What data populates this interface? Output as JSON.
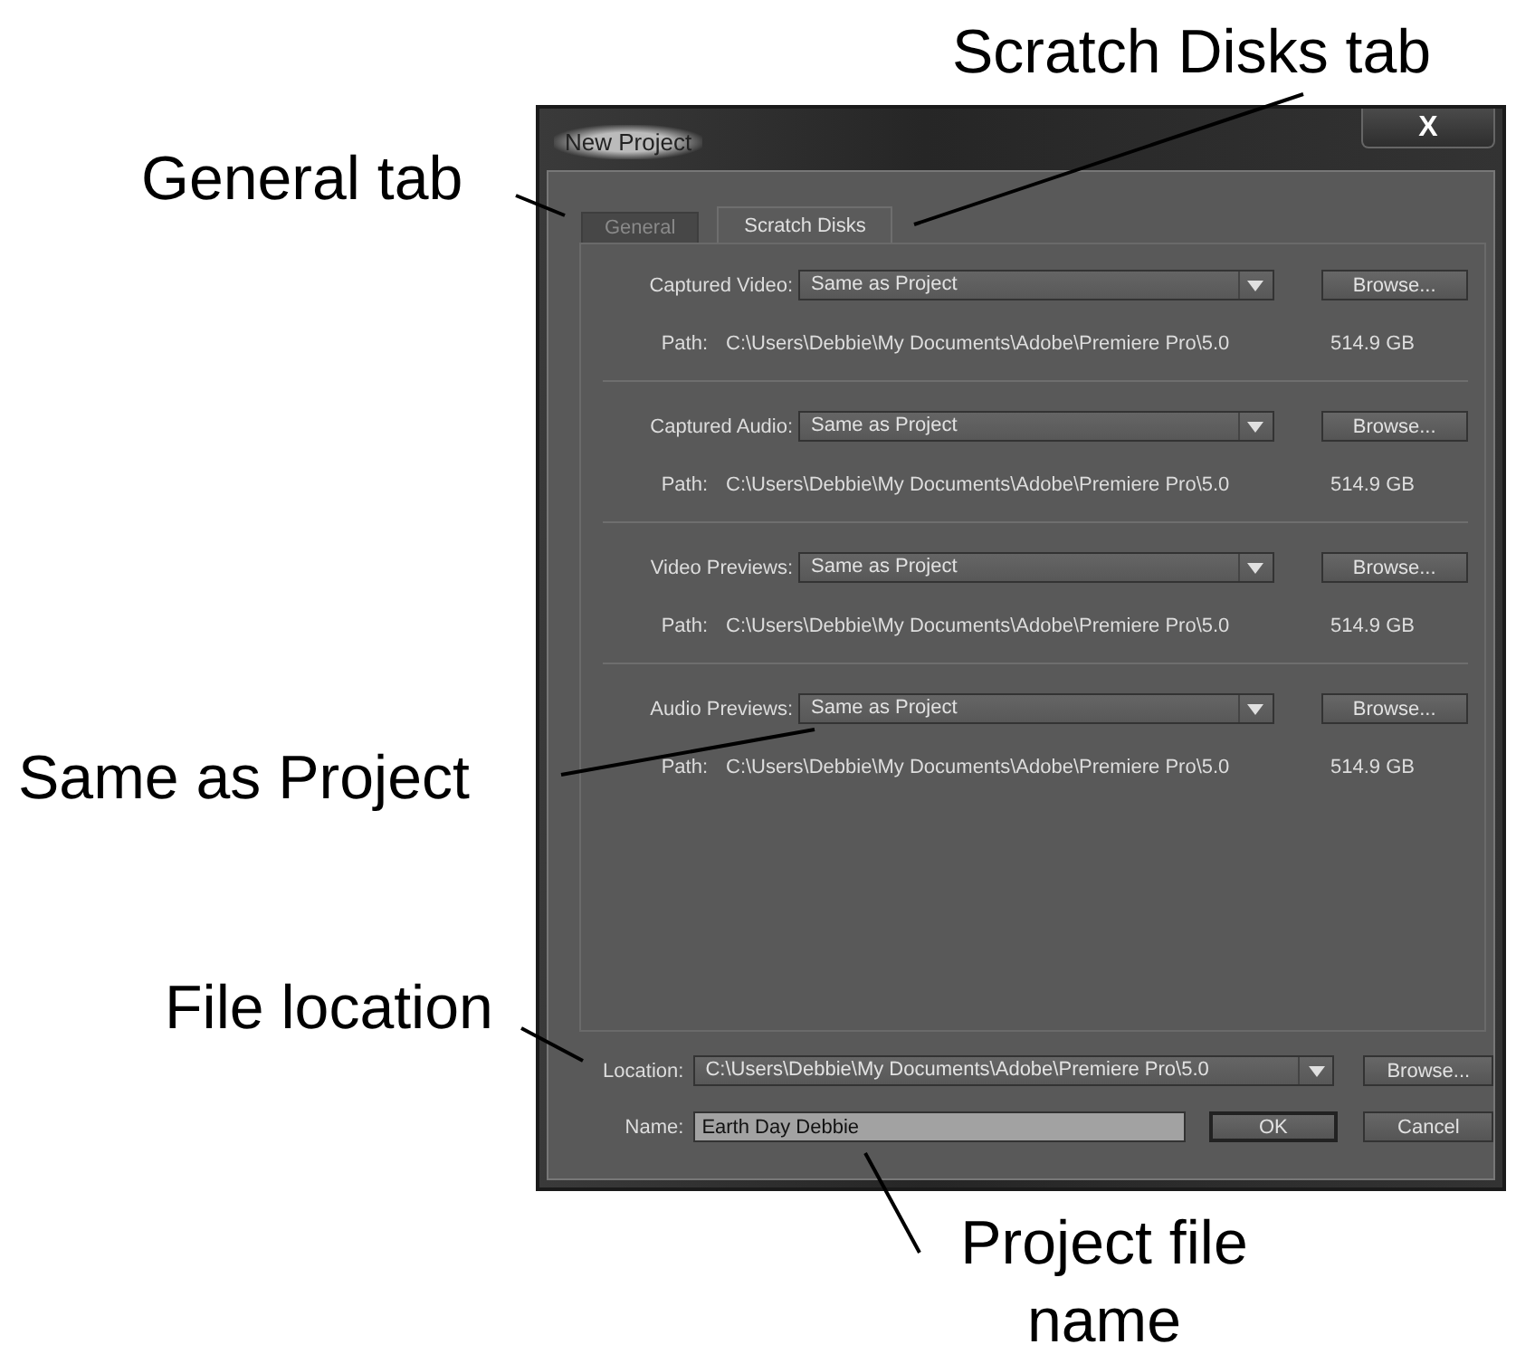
{
  "window": {
    "title": "New Project",
    "close": "X"
  },
  "tabs": [
    {
      "label": "General",
      "selected": false
    },
    {
      "label": "Scratch Disks",
      "selected": true
    }
  ],
  "scratch_disks": [
    {
      "label": "Captured Video:",
      "value": "Same as Project",
      "button": "Browse...",
      "path_label": "Path:",
      "path": "C:\\Users\\Debbie\\My Documents\\Adobe\\Premiere Pro\\5.0",
      "space": "514.9 GB"
    },
    {
      "label": "Captured Audio:",
      "value": "Same as Project",
      "button": "Browse...",
      "path_label": "Path:",
      "path": "C:\\Users\\Debbie\\My Documents\\Adobe\\Premiere Pro\\5.0",
      "space": "514.9 GB"
    },
    {
      "label": "Video Previews:",
      "value": "Same as Project",
      "button": "Browse...",
      "path_label": "Path:",
      "path": "C:\\Users\\Debbie\\My Documents\\Adobe\\Premiere Pro\\5.0",
      "space": "514.9 GB"
    },
    {
      "label": "Audio Previews:",
      "value": "Same as Project",
      "button": "Browse...",
      "path_label": "Path:",
      "path": "C:\\Users\\Debbie\\My Documents\\Adobe\\Premiere Pro\\5.0",
      "space": "514.9 GB"
    }
  ],
  "location": {
    "label": "Location:",
    "value": "C:\\Users\\Debbie\\My Documents\\Adobe\\Premiere Pro\\5.0",
    "button": "Browse..."
  },
  "name": {
    "label": "Name:",
    "value": "Earth Day Debbie"
  },
  "buttons": [
    {
      "label": "OK",
      "default": true
    },
    {
      "label": "Cancel",
      "default": false
    }
  ],
  "callouts": [
    {
      "text": "Scratch Disks tab"
    },
    {
      "text": "General tab"
    },
    {
      "text": "Same as Project"
    },
    {
      "text": "File location"
    },
    {
      "text": "Project file name"
    }
  ]
}
